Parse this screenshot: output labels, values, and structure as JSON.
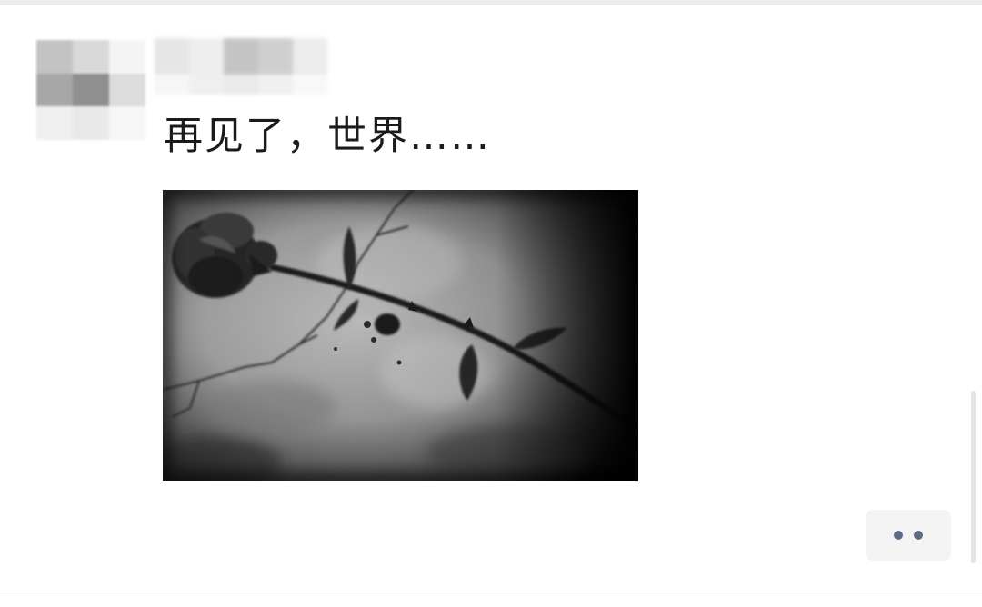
{
  "post": {
    "text": "再见了，世界……",
    "image": {
      "icon": "rose-photo",
      "description_colors": {
        "background_light": "#b9b9b9",
        "vignette": "#000000",
        "rose": "#2a2a2a"
      }
    }
  },
  "author": {
    "avatar_icon": "avatar-pixelated",
    "avatar_colors": [
      "#c3c3c3",
      "#d9d9d9",
      "#f4f4f4",
      "#a7a7a7",
      "#8f8f8f",
      "#dcdcdc",
      "#efefef",
      "#e9e9e9",
      "#f6f6f6"
    ],
    "name_colors": [
      "#e6e6e6",
      "#eeeeee",
      "#c5c5c5",
      "#cfcfcf",
      "#ececec",
      "#f6f6f6",
      "#efefef",
      "#eaeaea",
      "#f0f0f0",
      "#f8f8f8"
    ]
  },
  "actions": {
    "more_icon": "more-dots-icon",
    "dot_color": "#5e6a82",
    "button_bg": "#f3f3f3"
  }
}
